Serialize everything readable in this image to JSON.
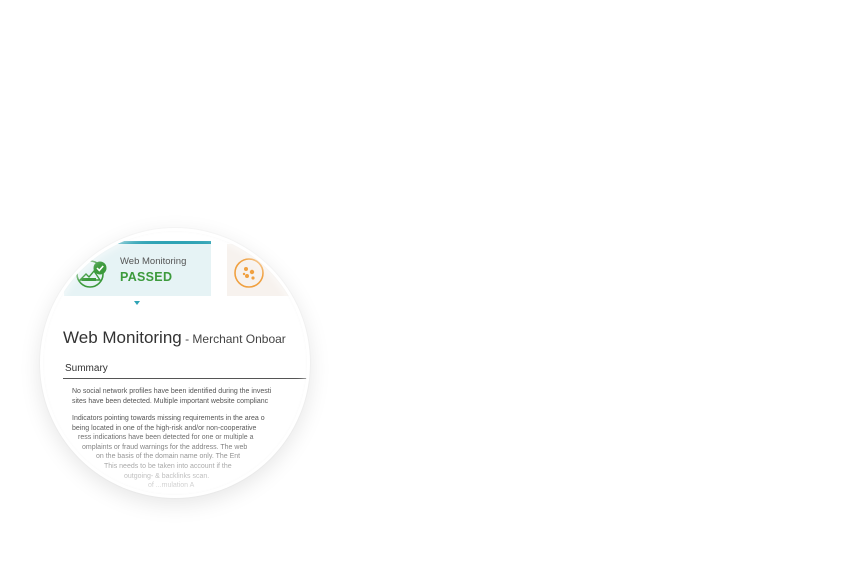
{
  "tabs": [
    {
      "title": "Web Monitoring",
      "status": "PASSED",
      "icon": "web-monitoring-check-icon",
      "accent": "#2ea3b5",
      "status_color": "#3c9a3c",
      "active": true
    },
    {
      "title": "",
      "status": "",
      "icon": "orange-cluster-icon",
      "accent": "#f0a040",
      "active": false
    }
  ],
  "page": {
    "title": "Web Monitoring",
    "subtitle": " - Merchant Onboar"
  },
  "summary": {
    "label": "Summary",
    "paragraph1": [
      "No social network profiles have been identified during the investi",
      "sites have been detected. Multiple important website complianc"
    ],
    "paragraph2": [
      "Indicators pointing towards missing requirements in the area o",
      "being located in one of the high-risk and/or non-cooperative",
      "ress indications have been detected for one or multiple a",
      "omplaints or fraud warnings for the address. The web",
      "on the basis of the domain name only. The Ent",
      "This needs to be taken into account if the",
      "outgoing- & backlinks scan.",
      "of ...mulation A"
    ]
  }
}
